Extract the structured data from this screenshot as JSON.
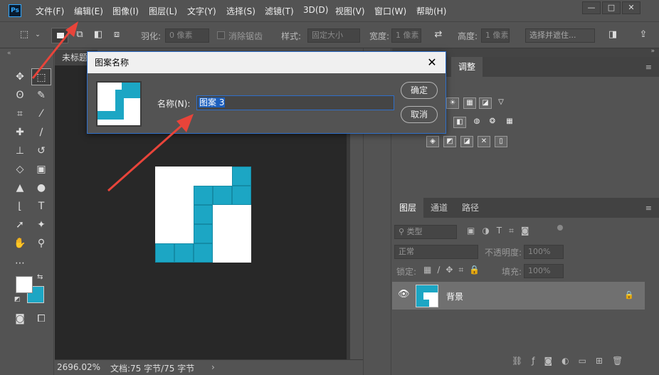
{
  "app": {
    "logo_text": "Ps",
    "accent": "#31a8ff"
  },
  "menu": [
    "文件(F)",
    "编辑(E)",
    "图像(I)",
    "图层(L)",
    "文字(Y)",
    "选择(S)",
    "滤镜(T)",
    "3D(D)",
    "视图(V)",
    "窗口(W)",
    "帮助(H)"
  ],
  "options": {
    "feather_label": "羽化:",
    "feather_value": "0 像素",
    "antialias_label": "消除锯齿",
    "style_label": "样式:",
    "style_value": "固定大小",
    "width_label": "宽度:",
    "width_value": "1 像素",
    "height_label": "高度:",
    "height_value": "1 像素",
    "select_mask_label": "选择并遮住..."
  },
  "document": {
    "tab_title": "未标题",
    "zoom": "2696.02%",
    "info": "文档:75 字节/75 字节"
  },
  "panels": {
    "adjust_tab": "调整",
    "layers_tabs": [
      "图层",
      "通道",
      "路径"
    ],
    "filter_kind": "类型",
    "blend_mode": "正常",
    "opacity_label": "不透明度:",
    "opacity_value": "100%",
    "lock_label": "锁定:",
    "fill_label": "填充:",
    "fill_value": "100%",
    "layer_name": "背景"
  },
  "dialog": {
    "title": "图案名称",
    "name_label": "名称(N):",
    "name_value": "图案 3",
    "ok_label": "确定",
    "cancel_label": "取消",
    "close_icon": "close-icon"
  },
  "colors": {
    "pattern_teal": "#1ca6c4",
    "arrow_red": "#e8443a",
    "selection_blue": "#2f6fc9"
  }
}
